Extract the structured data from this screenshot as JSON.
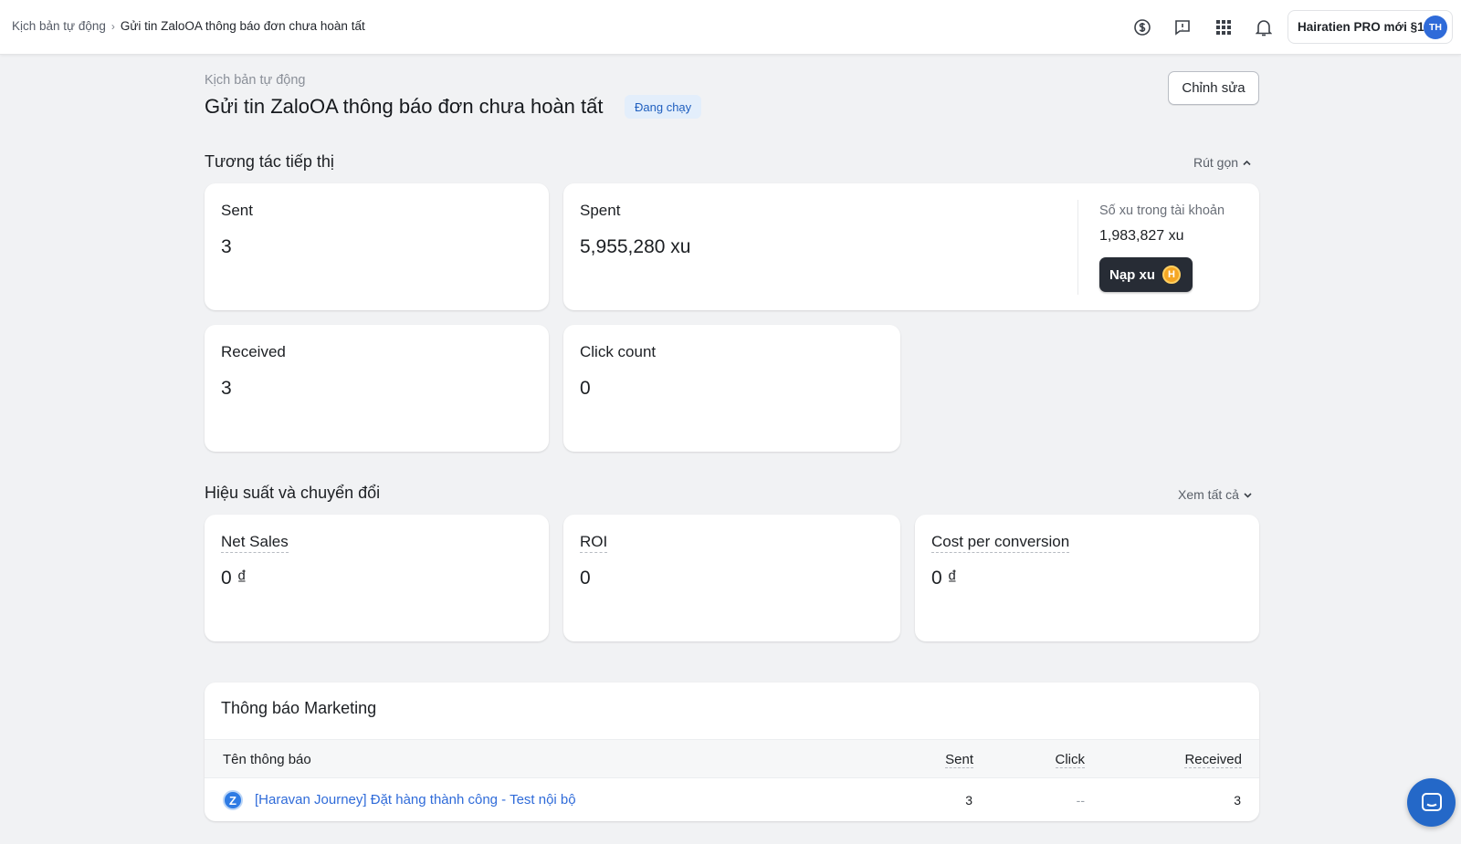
{
  "breadcrumb": {
    "parent": "Kịch bản tự động",
    "current": "Gửi tin ZaloOA thông báo đơn chưa hoàn tất"
  },
  "topbar": {
    "icons": [
      "currency-exchange-icon",
      "feedback-icon",
      "apps-grid-icon",
      "bell-icon"
    ],
    "store_name": "Hairatien PRO mới §1",
    "avatar_initials": "TH"
  },
  "header": {
    "subtitle": "Kịch bản tự động",
    "title": "Gửi tin ZaloOA thông báo đơn chưa hoàn tất",
    "status": "Đang chạy",
    "edit_label": "Chỉnh sửa"
  },
  "engagement": {
    "title": "Tương tác tiếp thị",
    "toggle_label": "Rút gọn",
    "sent_label": "Sent",
    "sent_value": "3",
    "spent_label": "Spent",
    "spent_value": "5,955,280 xu",
    "balance_label": "Số xu trong tài khoản",
    "balance_value": "1,983,827 xu",
    "topup_label": "Nạp xu",
    "coin_symbol": "H",
    "received_label": "Received",
    "received_value": "3",
    "click_label": "Click count",
    "click_value": "0"
  },
  "performance": {
    "title": "Hiệu suất và chuyển đổi",
    "toggle_label": "Xem tất cả",
    "net_sales_label": "Net Sales",
    "net_sales_value": "0 ₫",
    "roi_label": "ROI",
    "roi_value": "0",
    "cpc_label": "Cost per conversion",
    "cpc_value": "0 ₫"
  },
  "notifications": {
    "title": "Thông báo Marketing",
    "columns": [
      "Tên thông báo",
      "Sent",
      "Click",
      "Received"
    ],
    "rows": [
      {
        "name": "[Haravan Journey] Đặt hàng thành công - Test nội bộ",
        "sent": "3",
        "click": "--",
        "received": "3"
      }
    ]
  },
  "colors": {
    "accent": "#2f6bd9",
    "badge_bg": "#e3eefb",
    "topup_bg": "#272c35",
    "coin": "#f5a623",
    "chat_fab": "#2468c8"
  }
}
